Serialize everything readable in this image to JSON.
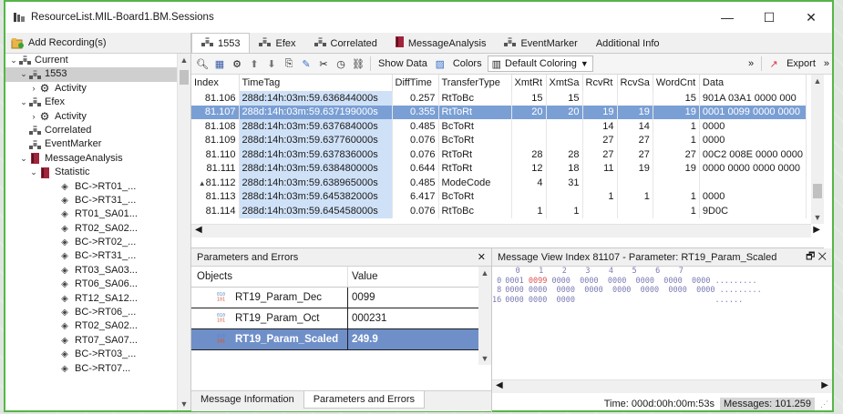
{
  "window": {
    "title": "ResourceList.MIL-Board1.BM.Sessions",
    "min": "—",
    "max": "☐",
    "close": "✕"
  },
  "left": {
    "add_recording": "Add Recording(s)",
    "tree": [
      {
        "label": "Current",
        "chev": "⌄",
        "indent": 0,
        "icon": "cluster"
      },
      {
        "label": "1553",
        "chev": "⌄",
        "indent": 1,
        "icon": "cluster",
        "selected": true
      },
      {
        "label": "Activity",
        "chev": "›",
        "indent": 2,
        "icon": "gears"
      },
      {
        "label": "Efex",
        "chev": "⌄",
        "indent": 1,
        "icon": "cluster"
      },
      {
        "label": "Activity",
        "chev": "›",
        "indent": 2,
        "icon": "gears"
      },
      {
        "label": "Correlated",
        "chev": "",
        "indent": 1,
        "icon": "cluster"
      },
      {
        "label": "EventMarker",
        "chev": "",
        "indent": 1,
        "icon": "cluster"
      },
      {
        "label": "MessageAnalysis",
        "chev": "⌄",
        "indent": 1,
        "icon": "book"
      },
      {
        "label": "Statistic",
        "chev": "⌄",
        "indent": 2,
        "icon": "book"
      },
      {
        "label": "BC->RT01_...",
        "chev": "",
        "indent": 4,
        "icon": "diamond"
      },
      {
        "label": "BC->RT31_...",
        "chev": "",
        "indent": 4,
        "icon": "diamond"
      },
      {
        "label": "RT01_SA01...",
        "chev": "",
        "indent": 4,
        "icon": "diamond"
      },
      {
        "label": "RT02_SA02...",
        "chev": "",
        "indent": 4,
        "icon": "diamond"
      },
      {
        "label": "BC->RT02_...",
        "chev": "",
        "indent": 4,
        "icon": "diamond"
      },
      {
        "label": "BC->RT31_...",
        "chev": "",
        "indent": 4,
        "icon": "diamond"
      },
      {
        "label": "RT03_SA03...",
        "chev": "",
        "indent": 4,
        "icon": "diamond"
      },
      {
        "label": "RT06_SA06...",
        "chev": "",
        "indent": 4,
        "icon": "diamond"
      },
      {
        "label": "RT12_SA12...",
        "chev": "",
        "indent": 4,
        "icon": "diamond"
      },
      {
        "label": "BC->RT06_...",
        "chev": "",
        "indent": 4,
        "icon": "diamond"
      },
      {
        "label": "RT02_SA02...",
        "chev": "",
        "indent": 4,
        "icon": "diamond"
      },
      {
        "label": "RT07_SA07...",
        "chev": "",
        "indent": 4,
        "icon": "diamond"
      },
      {
        "label": "BC->RT03_...",
        "chev": "",
        "indent": 4,
        "icon": "diamond"
      },
      {
        "label": "BC->RT07...",
        "chev": "",
        "indent": 4,
        "icon": "diamond"
      }
    ]
  },
  "tabs": [
    {
      "label": "1553",
      "active": true,
      "icon": "cluster"
    },
    {
      "label": "Efex",
      "icon": "cluster"
    },
    {
      "label": "Correlated",
      "icon": "cluster"
    },
    {
      "label": "MessageAnalysis",
      "icon": "book"
    },
    {
      "label": "EventMarker",
      "icon": "cluster"
    },
    {
      "label": "Additional Info",
      "icon": ""
    }
  ],
  "toolbar": {
    "show_data": "Show Data",
    "colors": "Colors",
    "coloring": "Default Coloring",
    "more": "»",
    "export": "Export",
    "export_more": "»"
  },
  "grid": {
    "columns": [
      "Index",
      "TimeTag",
      "DiffTime",
      "TransferType",
      "XmtRt",
      "XmtSa",
      "RcvRt",
      "RcvSa",
      "WordCnt",
      "Data"
    ],
    "rows": [
      [
        "81.106",
        "288d:14h:03m:59.636844000s",
        "0.257",
        "RtToBc",
        "15",
        "15",
        "",
        "",
        "15",
        "901A 03A1 0000 000"
      ],
      [
        "81.107",
        "288d:14h:03m:59.637199000s",
        "0.355",
        "RtToRt",
        "20",
        "20",
        "19",
        "19",
        "19",
        "0001 0099 0000 0000"
      ],
      [
        "81.108",
        "288d:14h:03m:59.637684000s",
        "0.485",
        "BcToRt",
        "",
        "",
        "14",
        "14",
        "1",
        "0000"
      ],
      [
        "81.109",
        "288d:14h:03m:59.637760000s",
        "0.076",
        "BcToRt",
        "",
        "",
        "27",
        "27",
        "1",
        "0000"
      ],
      [
        "81.110",
        "288d:14h:03m:59.637836000s",
        "0.076",
        "RtToRt",
        "28",
        "28",
        "27",
        "27",
        "27",
        "00C2 008E 0000 0000"
      ],
      [
        "81.111",
        "288d:14h:03m:59.638480000s",
        "0.644",
        "RtToRt",
        "12",
        "18",
        "11",
        "19",
        "19",
        "0000 0000 0000 0000"
      ],
      [
        "81.112",
        "288d:14h:03m:59.638965000s",
        "0.485",
        "ModeCode",
        "4",
        "31",
        "",
        "",
        "",
        ""
      ],
      [
        "81.113",
        "288d:14h:03m:59.645382000s",
        "6.417",
        "BcToRt",
        "",
        "",
        "1",
        "1",
        "1",
        "0000"
      ],
      [
        "81.114",
        "288d:14h:03m:59.645458000s",
        "0.076",
        "RtToBc",
        "1",
        "1",
        "",
        "",
        "1",
        "9D0C"
      ]
    ],
    "current_marker": "▲"
  },
  "params": {
    "title": "Parameters and Errors",
    "close": "✕",
    "col_objects": "Objects",
    "col_value": "Value",
    "rows": [
      {
        "name": "RT19_Param_Dec",
        "value": "0099"
      },
      {
        "name": "RT19_Param_Oct",
        "value": "000231"
      },
      {
        "name": "RT19_Param_Scaled",
        "value": "249.9",
        "selected": true
      }
    ],
    "tab_info": "Message Information",
    "tab_params": "Parameters and Errors"
  },
  "msgview": {
    "title": "Message View Index 81107 - Parameter: RT19_Param_Scaled",
    "pin": "🗗",
    "close": "✕",
    "header": "     0    1    2    3    4    5    6    7",
    "lines": [
      {
        "addr": " 0",
        "pre": "0001 ",
        "red": "0099",
        "post": " 0000  0000  0000  0000  0000  0000",
        "dots": " ........."
      },
      {
        "addr": " 8",
        "pre": "0000 ",
        "red": "",
        "post": "0000  0000  0000  0000  0000  0000  0000",
        "dots": " ........."
      },
      {
        "addr": "16",
        "pre": "0000 ",
        "red": "",
        "post": "0000  0000",
        "dots": "                              ......"
      }
    ]
  },
  "status": {
    "time": "Time: 000d:00h:00m:53s",
    "messages": "Messages: 101.259"
  }
}
